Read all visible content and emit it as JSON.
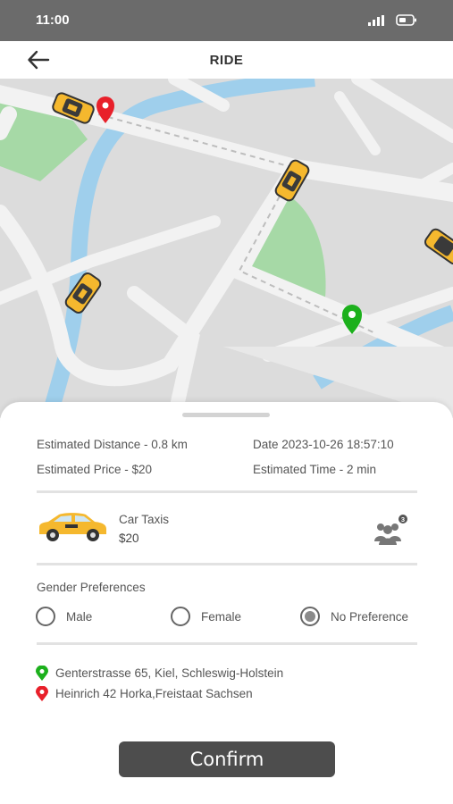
{
  "status_bar": {
    "time": "11:00"
  },
  "header": {
    "title": "RIDE"
  },
  "trip": {
    "distance": "Estimated Distance - 0.8 km",
    "date": "Date 2023-10-26 18:57:10",
    "price": "Estimated Price - $20",
    "time": "Estimated Time - 2 min"
  },
  "ride_option": {
    "name": "Car Taxis",
    "price": "$20",
    "seats_badge": "3"
  },
  "gender": {
    "title": "Gender Preferences",
    "options": [
      {
        "label": "Male",
        "selected": false
      },
      {
        "label": "Female",
        "selected": false
      },
      {
        "label": "No Preference",
        "selected": true
      }
    ]
  },
  "addresses": {
    "pickup": "Genterstrasse 65, Kiel, Schleswig-Holstein",
    "dropoff": "Heinrich 42 Horka,Freistaat Sachsen"
  },
  "confirm_label": "Confirm",
  "colors": {
    "status_bar": "#6b6b6b",
    "taxi_yellow": "#f5b82e",
    "pickup_pin": "#1cb01c",
    "dropoff_pin": "#e8202a",
    "button": "#4d4d4d",
    "map_water": "#9fcfec",
    "map_park": "#a6d9a6"
  }
}
